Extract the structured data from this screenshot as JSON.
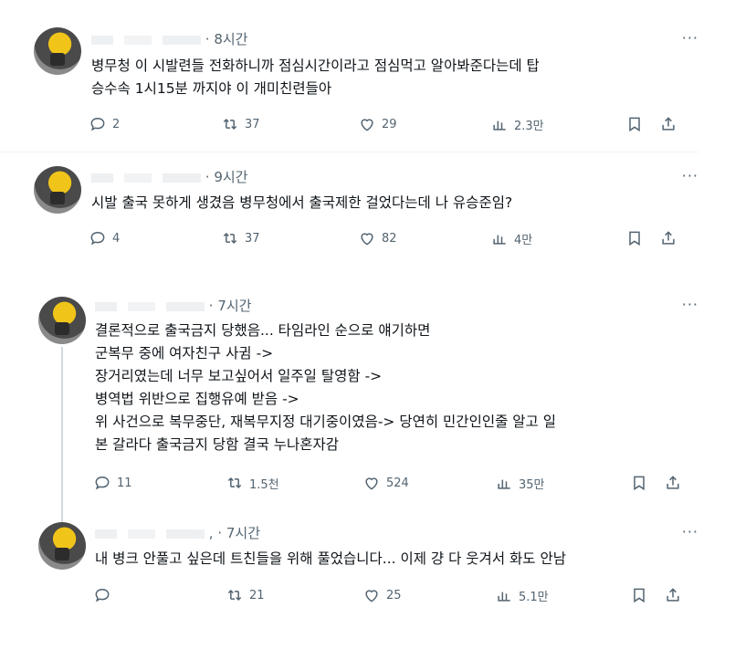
{
  "tweets": [
    {
      "time": "· 8시간",
      "text": "병무청 이 시발련들 전화하니까 점심시간이라고 점심먹고 알아봐준다는데 탑\n승수속 1시15분 까지야 이 개미친련들아",
      "replies": "2",
      "retweets": "37",
      "likes": "29",
      "views": "2.3만"
    },
    {
      "time": "· 9시간",
      "text": "시발 출국 못하게 생겼음 병무청에서 출국제한 걸었다는데 나 유승준임?",
      "replies": "4",
      "retweets": "37",
      "likes": "82",
      "views": "4만"
    },
    {
      "time": "· 7시간",
      "text": "결론적으로 출국금지 당했음... 타임라인 순으로 얘기하면\n군복무 중에 여자친구 사귐 ->\n장거리였는데 너무 보고싶어서 일주일 탈영함 ->\n병역법 위반으로 집행유예 받음 ->\n위 사건으로 복무중단, 재복무지정 대기중이였음-> 당연히 민간인인줄 알고 일\n본 갈라다 출국금지 당함 결국 누나혼자감",
      "replies": "11",
      "retweets": "1.5천",
      "likes": "524",
      "views": "35만"
    },
    {
      "time": ", · 7시간",
      "text": "내 병크 안풀고 싶은데 트친들을 위해 풀었습니다... 이제 걍 다 웃겨서 화도 안남",
      "replies": "",
      "retweets": "21",
      "likes": "25",
      "views": "5.1만"
    }
  ],
  "more_label": "···",
  "icons": [
    "reply-icon",
    "retweet-icon",
    "like-icon",
    "views-icon",
    "bookmark-icon",
    "share-icon"
  ]
}
